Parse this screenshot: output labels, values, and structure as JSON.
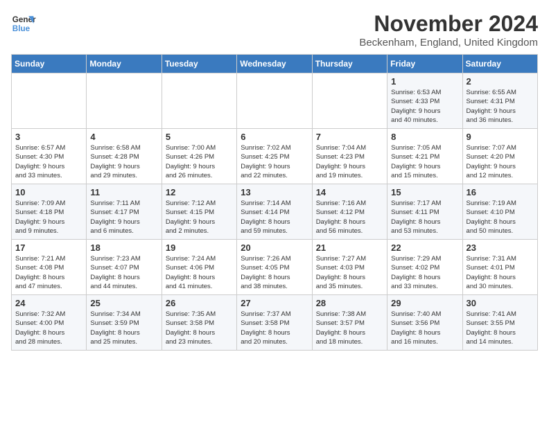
{
  "header": {
    "logo_line1": "General",
    "logo_line2": "Blue",
    "month_title": "November 2024",
    "location": "Beckenham, England, United Kingdom"
  },
  "days_of_week": [
    "Sunday",
    "Monday",
    "Tuesday",
    "Wednesday",
    "Thursday",
    "Friday",
    "Saturday"
  ],
  "weeks": [
    [
      {
        "day": "",
        "info": ""
      },
      {
        "day": "",
        "info": ""
      },
      {
        "day": "",
        "info": ""
      },
      {
        "day": "",
        "info": ""
      },
      {
        "day": "",
        "info": ""
      },
      {
        "day": "1",
        "info": "Sunrise: 6:53 AM\nSunset: 4:33 PM\nDaylight: 9 hours\nand 40 minutes."
      },
      {
        "day": "2",
        "info": "Sunrise: 6:55 AM\nSunset: 4:31 PM\nDaylight: 9 hours\nand 36 minutes."
      }
    ],
    [
      {
        "day": "3",
        "info": "Sunrise: 6:57 AM\nSunset: 4:30 PM\nDaylight: 9 hours\nand 33 minutes."
      },
      {
        "day": "4",
        "info": "Sunrise: 6:58 AM\nSunset: 4:28 PM\nDaylight: 9 hours\nand 29 minutes."
      },
      {
        "day": "5",
        "info": "Sunrise: 7:00 AM\nSunset: 4:26 PM\nDaylight: 9 hours\nand 26 minutes."
      },
      {
        "day": "6",
        "info": "Sunrise: 7:02 AM\nSunset: 4:25 PM\nDaylight: 9 hours\nand 22 minutes."
      },
      {
        "day": "7",
        "info": "Sunrise: 7:04 AM\nSunset: 4:23 PM\nDaylight: 9 hours\nand 19 minutes."
      },
      {
        "day": "8",
        "info": "Sunrise: 7:05 AM\nSunset: 4:21 PM\nDaylight: 9 hours\nand 15 minutes."
      },
      {
        "day": "9",
        "info": "Sunrise: 7:07 AM\nSunset: 4:20 PM\nDaylight: 9 hours\nand 12 minutes."
      }
    ],
    [
      {
        "day": "10",
        "info": "Sunrise: 7:09 AM\nSunset: 4:18 PM\nDaylight: 9 hours\nand 9 minutes."
      },
      {
        "day": "11",
        "info": "Sunrise: 7:11 AM\nSunset: 4:17 PM\nDaylight: 9 hours\nand 6 minutes."
      },
      {
        "day": "12",
        "info": "Sunrise: 7:12 AM\nSunset: 4:15 PM\nDaylight: 9 hours\nand 2 minutes."
      },
      {
        "day": "13",
        "info": "Sunrise: 7:14 AM\nSunset: 4:14 PM\nDaylight: 8 hours\nand 59 minutes."
      },
      {
        "day": "14",
        "info": "Sunrise: 7:16 AM\nSunset: 4:12 PM\nDaylight: 8 hours\nand 56 minutes."
      },
      {
        "day": "15",
        "info": "Sunrise: 7:17 AM\nSunset: 4:11 PM\nDaylight: 8 hours\nand 53 minutes."
      },
      {
        "day": "16",
        "info": "Sunrise: 7:19 AM\nSunset: 4:10 PM\nDaylight: 8 hours\nand 50 minutes."
      }
    ],
    [
      {
        "day": "17",
        "info": "Sunrise: 7:21 AM\nSunset: 4:08 PM\nDaylight: 8 hours\nand 47 minutes."
      },
      {
        "day": "18",
        "info": "Sunrise: 7:23 AM\nSunset: 4:07 PM\nDaylight: 8 hours\nand 44 minutes."
      },
      {
        "day": "19",
        "info": "Sunrise: 7:24 AM\nSunset: 4:06 PM\nDaylight: 8 hours\nand 41 minutes."
      },
      {
        "day": "20",
        "info": "Sunrise: 7:26 AM\nSunset: 4:05 PM\nDaylight: 8 hours\nand 38 minutes."
      },
      {
        "day": "21",
        "info": "Sunrise: 7:27 AM\nSunset: 4:03 PM\nDaylight: 8 hours\nand 35 minutes."
      },
      {
        "day": "22",
        "info": "Sunrise: 7:29 AM\nSunset: 4:02 PM\nDaylight: 8 hours\nand 33 minutes."
      },
      {
        "day": "23",
        "info": "Sunrise: 7:31 AM\nSunset: 4:01 PM\nDaylight: 8 hours\nand 30 minutes."
      }
    ],
    [
      {
        "day": "24",
        "info": "Sunrise: 7:32 AM\nSunset: 4:00 PM\nDaylight: 8 hours\nand 28 minutes."
      },
      {
        "day": "25",
        "info": "Sunrise: 7:34 AM\nSunset: 3:59 PM\nDaylight: 8 hours\nand 25 minutes."
      },
      {
        "day": "26",
        "info": "Sunrise: 7:35 AM\nSunset: 3:58 PM\nDaylight: 8 hours\nand 23 minutes."
      },
      {
        "day": "27",
        "info": "Sunrise: 7:37 AM\nSunset: 3:58 PM\nDaylight: 8 hours\nand 20 minutes."
      },
      {
        "day": "28",
        "info": "Sunrise: 7:38 AM\nSunset: 3:57 PM\nDaylight: 8 hours\nand 18 minutes."
      },
      {
        "day": "29",
        "info": "Sunrise: 7:40 AM\nSunset: 3:56 PM\nDaylight: 8 hours\nand 16 minutes."
      },
      {
        "day": "30",
        "info": "Sunrise: 7:41 AM\nSunset: 3:55 PM\nDaylight: 8 hours\nand 14 minutes."
      }
    ]
  ]
}
